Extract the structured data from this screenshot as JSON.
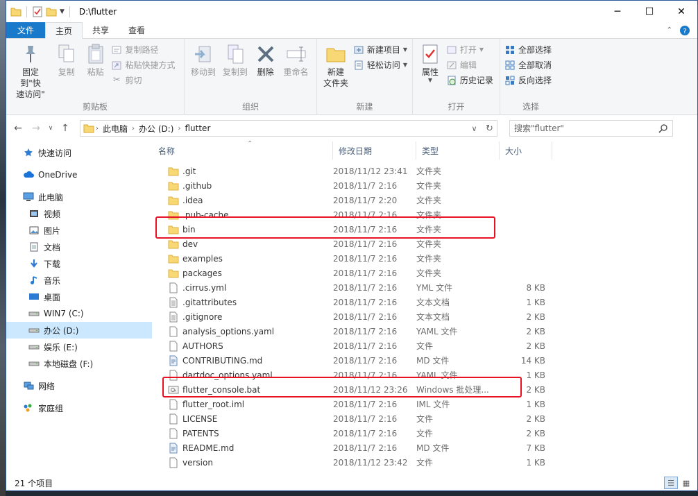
{
  "window": {
    "title": "D:\\flutter",
    "controls": [
      "─",
      "☐",
      "✕"
    ]
  },
  "ribbon_tabs": [
    "文件",
    "主页",
    "共享",
    "查看"
  ],
  "ribbon": {
    "clipboard": {
      "label": "剪贴板",
      "pin": "固定到\"快\n速访问\"",
      "copy": "复制",
      "paste": "粘贴",
      "copy_path": "复制路径",
      "paste_shortcut": "粘贴快捷方式",
      "cut": "剪切"
    },
    "organize": {
      "label": "组织",
      "move_to": "移动到",
      "copy_to": "复制到",
      "delete": "删除",
      "rename": "重命名"
    },
    "new": {
      "label": "新建",
      "new_folder": "新建\n文件夹",
      "new_item": "新建项目",
      "easy_access": "轻松访问"
    },
    "open": {
      "label": "打开",
      "properties": "属性",
      "open": "打开",
      "edit": "编辑",
      "history": "历史记录"
    },
    "select": {
      "label": "选择",
      "select_all": "全部选择",
      "select_none": "全部取消",
      "invert": "反向选择"
    }
  },
  "address": {
    "crumbs": [
      "此电脑",
      "办公 (D:)",
      "flutter"
    ]
  },
  "search": {
    "placeholder": "搜索\"flutter\""
  },
  "sidebar": {
    "items": [
      {
        "label": "快速访问",
        "icon": "star-icon"
      },
      {
        "label": "OneDrive",
        "icon": "cloud-icon"
      },
      {
        "label": "此电脑",
        "icon": "computer-icon"
      },
      {
        "label": "视频",
        "icon": "video-icon"
      },
      {
        "label": "图片",
        "icon": "picture-icon"
      },
      {
        "label": "文档",
        "icon": "document-icon"
      },
      {
        "label": "下载",
        "icon": "download-icon"
      },
      {
        "label": "音乐",
        "icon": "music-icon"
      },
      {
        "label": "桌面",
        "icon": "desktop-icon"
      },
      {
        "label": "WIN7 (C:)",
        "icon": "drive-icon"
      },
      {
        "label": "办公 (D:)",
        "icon": "drive-icon"
      },
      {
        "label": "娱乐 (E:)",
        "icon": "drive-icon"
      },
      {
        "label": "本地磁盘 (F:)",
        "icon": "drive-icon"
      },
      {
        "label": "网络",
        "icon": "network-icon"
      },
      {
        "label": "家庭组",
        "icon": "homegroup-icon"
      }
    ]
  },
  "columns": {
    "name": "名称",
    "date": "修改日期",
    "type": "类型",
    "size": "大小"
  },
  "files": [
    {
      "name": ".git",
      "date": "2018/11/12 23:41",
      "type": "文件夹",
      "size": "",
      "kind": "folder"
    },
    {
      "name": ".github",
      "date": "2018/11/7 2:16",
      "type": "文件夹",
      "size": "",
      "kind": "folder"
    },
    {
      "name": ".idea",
      "date": "2018/11/7 2:20",
      "type": "文件夹",
      "size": "",
      "kind": "folder"
    },
    {
      "name": ".pub-cache",
      "date": "2018/11/7 2:16",
      "type": "文件夹",
      "size": "",
      "kind": "folder"
    },
    {
      "name": "bin",
      "date": "2018/11/7 2:16",
      "type": "文件夹",
      "size": "",
      "kind": "folder"
    },
    {
      "name": "dev",
      "date": "2018/11/7 2:16",
      "type": "文件夹",
      "size": "",
      "kind": "folder"
    },
    {
      "name": "examples",
      "date": "2018/11/7 2:16",
      "type": "文件夹",
      "size": "",
      "kind": "folder"
    },
    {
      "name": "packages",
      "date": "2018/11/7 2:16",
      "type": "文件夹",
      "size": "",
      "kind": "folder"
    },
    {
      "name": ".cirrus.yml",
      "date": "2018/11/7 2:16",
      "type": "YML 文件",
      "size": "8 KB",
      "kind": "file"
    },
    {
      "name": ".gitattributes",
      "date": "2018/11/7 2:16",
      "type": "文本文档",
      "size": "1 KB",
      "kind": "text"
    },
    {
      "name": ".gitignore",
      "date": "2018/11/7 2:16",
      "type": "文本文档",
      "size": "2 KB",
      "kind": "text"
    },
    {
      "name": "analysis_options.yaml",
      "date": "2018/11/7 2:16",
      "type": "YAML 文件",
      "size": "2 KB",
      "kind": "file"
    },
    {
      "name": "AUTHORS",
      "date": "2018/11/7 2:16",
      "type": "文件",
      "size": "2 KB",
      "kind": "file"
    },
    {
      "name": "CONTRIBUTING.md",
      "date": "2018/11/7 2:16",
      "type": "MD 文件",
      "size": "14 KB",
      "kind": "md"
    },
    {
      "name": "dartdoc_options.yaml",
      "date": "2018/11/7 2:16",
      "type": "YAML 文件",
      "size": "1 KB",
      "kind": "file"
    },
    {
      "name": "flutter_console.bat",
      "date": "2018/11/12 23:26",
      "type": "Windows 批处理...",
      "size": "2 KB",
      "kind": "bat"
    },
    {
      "name": "flutter_root.iml",
      "date": "2018/11/7 2:16",
      "type": "IML 文件",
      "size": "1 KB",
      "kind": "file"
    },
    {
      "name": "LICENSE",
      "date": "2018/11/7 2:16",
      "type": "文件",
      "size": "2 KB",
      "kind": "file"
    },
    {
      "name": "PATENTS",
      "date": "2018/11/7 2:16",
      "type": "文件",
      "size": "2 KB",
      "kind": "file"
    },
    {
      "name": "README.md",
      "date": "2018/11/7 2:16",
      "type": "MD 文件",
      "size": "7 KB",
      "kind": "md"
    },
    {
      "name": "version",
      "date": "2018/11/12 23:42",
      "type": "文件",
      "size": "1 KB",
      "kind": "file"
    }
  ],
  "status": {
    "count": "21 个项目"
  },
  "colors": {
    "accent": "#1979ca",
    "highlight": "#e81123",
    "selected": "#cce8ff",
    "folder": "#f8d775"
  }
}
